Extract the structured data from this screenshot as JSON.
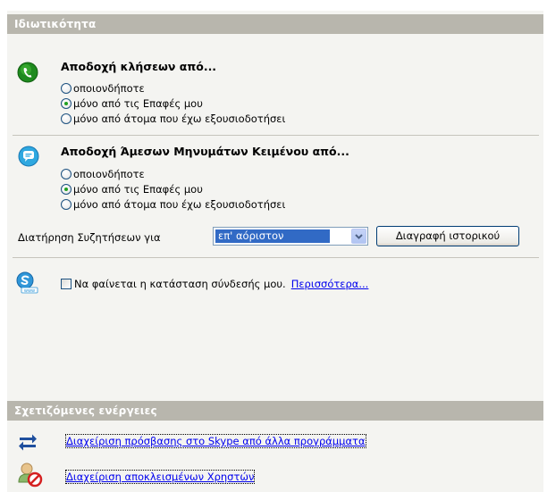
{
  "privacy": {
    "header": "Ιδιωτικότητα",
    "calls": {
      "title": "Αποδοχή κλήσεων από...",
      "options": [
        "οποιονδήποτε",
        "μόνο από τις Επαφές μου",
        "μόνο από άτομα που έχω εξουσιοδοτήσει"
      ],
      "selected_index": 1
    },
    "messages": {
      "title": "Αποδοχή Άμεσων Μηνυμάτων Κειμένου από...",
      "options": [
        "οποιονδήποτε",
        "μόνο από τις Επαφές μου",
        "μόνο από άτομα που έχω εξουσιοδοτήσει"
      ],
      "selected_index": 1
    },
    "history": {
      "label": "Διατήρηση Συζητήσεων για",
      "selected_value": "επ' αόριστον",
      "clear_button": "Διαγραφή ιστορικού"
    },
    "status": {
      "checkbox_label": "Να φαίνεται η κατάσταση σύνδεσής μου.",
      "checked": false,
      "more_link": "Περισσότερα..."
    }
  },
  "related": {
    "header": "Σχετιζόμενες ενέργειες",
    "links": [
      {
        "label": "Διαχείριση πρόσβασης στο Skype από άλλα προγράμματα",
        "icon": "arrows-icon"
      },
      {
        "label": "Διαχείριση αποκλεισμένων Χρηστών",
        "icon": "blocked-user-icon"
      }
    ]
  },
  "colors": {
    "header_bg": "#b8b6ad",
    "panel_bg": "#f4f4f1",
    "link": "#0000ee",
    "selection": "#316ac5",
    "call_green": "#1e8a1e",
    "skype_blue": "#2fa8e0"
  }
}
